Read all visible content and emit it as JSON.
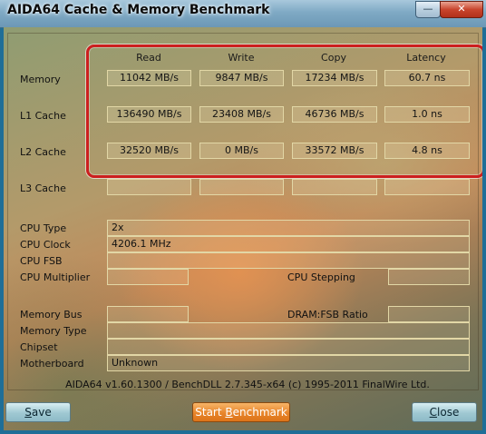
{
  "window": {
    "title": "AIDA64 Cache & Memory Benchmark",
    "minimize_glyph": "—",
    "close_glyph": "✕"
  },
  "columns": [
    "Read",
    "Write",
    "Copy",
    "Latency"
  ],
  "rows": [
    {
      "label": "Memory",
      "values": [
        "11042 MB/s",
        "9847 MB/s",
        "17234 MB/s",
        "60.7 ns"
      ]
    },
    {
      "label": "L1 Cache",
      "values": [
        "136490 MB/s",
        "23408 MB/s",
        "46736 MB/s",
        "1.0 ns"
      ]
    },
    {
      "label": "L2 Cache",
      "values": [
        "32520 MB/s",
        "0 MB/s",
        "33572 MB/s",
        "4.8 ns"
      ]
    },
    {
      "label": "L3 Cache",
      "values": [
        "",
        "",
        "",
        ""
      ]
    }
  ],
  "info": {
    "cpu_type_label": "CPU Type",
    "cpu_type_value": "2x",
    "cpu_clock_label": "CPU Clock",
    "cpu_clock_value": "4206.1 MHz",
    "cpu_fsb_label": "CPU FSB",
    "cpu_fsb_value": "",
    "cpu_multiplier_label": "CPU Multiplier",
    "cpu_multiplier_value": "",
    "cpu_stepping_label": "CPU Stepping",
    "cpu_stepping_value": "",
    "memory_bus_label": "Memory Bus",
    "memory_bus_value": "",
    "dram_fsb_label": "DRAM:FSB Ratio",
    "dram_fsb_value": "",
    "memory_type_label": "Memory Type",
    "memory_type_value": "",
    "chipset_label": "Chipset",
    "chipset_value": "",
    "motherboard_label": "Motherboard",
    "motherboard_value": "Unknown"
  },
  "footer": "AIDA64 v1.60.1300 / BenchDLL 2.7.345-x64  (c) 1995-2011 FinalWire Ltd.",
  "buttons": {
    "save_accel": "S",
    "save_rest": "ave",
    "start_prefix": "Start ",
    "start_accel": "B",
    "start_rest": "enchmark",
    "close_accel": "C",
    "close_rest": "lose"
  },
  "colors": {
    "highlight": "#cc1f1f",
    "start_button": "#e8852b",
    "secondary_button": "#9fc8d2"
  }
}
